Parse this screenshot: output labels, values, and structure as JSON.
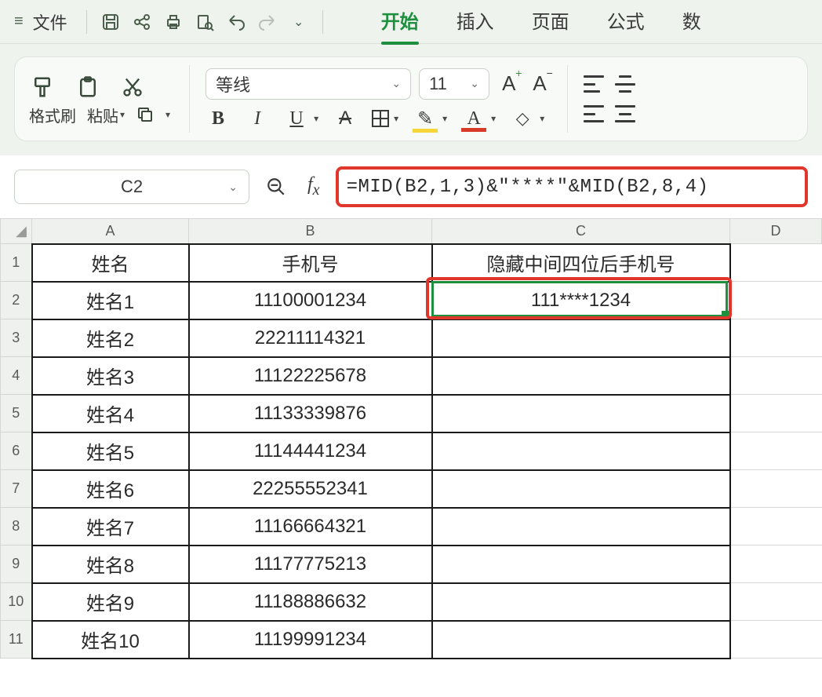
{
  "menubar": {
    "file_label": "文件",
    "tabs": [
      "开始",
      "插入",
      "页面",
      "公式",
      "数"
    ]
  },
  "ribbon": {
    "format_painter": "格式刷",
    "paste": "粘贴",
    "font_name": "等线",
    "font_size": "11"
  },
  "namebox": "C2",
  "formula": "=MID(B2,1,3)&\"****\"&MID(B2,8,4)",
  "columns": [
    "A",
    "B",
    "C",
    "D"
  ],
  "headers": {
    "A": "姓名",
    "B": "手机号",
    "C": "隐藏中间四位后手机号"
  },
  "rows": [
    {
      "n": "1",
      "A": "姓名",
      "B": "手机号",
      "C": "隐藏中间四位后手机号"
    },
    {
      "n": "2",
      "A": "姓名1",
      "B": "11100001234",
      "C": "111****1234"
    },
    {
      "n": "3",
      "A": "姓名2",
      "B": "22211114321",
      "C": ""
    },
    {
      "n": "4",
      "A": "姓名3",
      "B": "11122225678",
      "C": ""
    },
    {
      "n": "5",
      "A": "姓名4",
      "B": "11133339876",
      "C": ""
    },
    {
      "n": "6",
      "A": "姓名5",
      "B": "11144441234",
      "C": ""
    },
    {
      "n": "7",
      "A": "姓名6",
      "B": "22255552341",
      "C": ""
    },
    {
      "n": "8",
      "A": "姓名7",
      "B": "11166664321",
      "C": ""
    },
    {
      "n": "9",
      "A": "姓名8",
      "B": "11177775213",
      "C": ""
    },
    {
      "n": "10",
      "A": "姓名9",
      "B": "11188886632",
      "C": ""
    },
    {
      "n": "11",
      "A": "姓名10",
      "B": "11199991234",
      "C": ""
    }
  ]
}
